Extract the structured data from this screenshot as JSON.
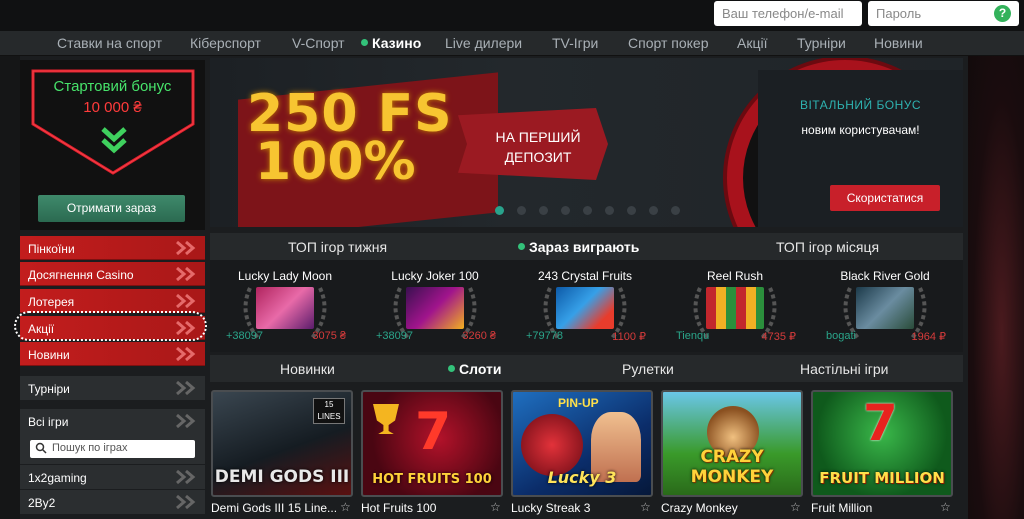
{
  "login": {
    "phone_placeholder": "Ваш телефон/e-mail",
    "password_placeholder": "Пароль",
    "help_label": "?"
  },
  "nav": {
    "items": [
      "Ставки на спорт",
      "Кіберспорт",
      "V-Спорт",
      "Казино",
      "Live дилери",
      "TV-Ігри",
      "Спорт покер",
      "Акції",
      "Турніри",
      "Новини"
    ],
    "active_index": 3
  },
  "bonus": {
    "title": "Стартовий бонус",
    "amount": "10 000 ₴",
    "button": "Отримати зараз"
  },
  "banner": {
    "fs_text": "250 FS",
    "percent_text": "100%",
    "ribbon_line1": "НА ПЕРШИЙ",
    "ribbon_line2": "ДЕПОЗИТ",
    "welcome_title": "ВІТАЛЬНИЙ БОНУС",
    "welcome_sub": "новим користувачам!",
    "use_button": "Скористатися",
    "slide_count": 9,
    "active_slide": 0
  },
  "sidebar": {
    "red_items": [
      "Пінкоїни",
      "Досягнення Casino",
      "Лотерея",
      "Акції",
      "Новини"
    ],
    "highlighted_index": 3,
    "tournaments": "Турніри",
    "all_games": "Всі ігри",
    "search_placeholder": "Пошук по іграх",
    "providers": [
      "1x2gaming",
      "2By2"
    ]
  },
  "top_tabs": {
    "items": [
      "ТОП ігор тижня",
      "Зараз виграють",
      "ТОП ігор місяця"
    ],
    "active_index": 1
  },
  "top_games": [
    {
      "title": "Lucky Lady Moon",
      "user": "+38097",
      "amount": "3075 ₴"
    },
    {
      "title": "Lucky Joker 100",
      "user": "+38097",
      "amount": "3260 ₴"
    },
    {
      "title": "243 Crystal Fruits",
      "user": "+79778",
      "amount": "1100 ₽"
    },
    {
      "title": "Reel Rush",
      "user": "Tienqu",
      "amount": "4735 ₽"
    },
    {
      "title": "Black River Gold",
      "user": "bogati",
      "amount": "1964 ₽"
    }
  ],
  "category_tabs": {
    "items": [
      "Новинки",
      "Слоти",
      "Рулетки",
      "Настільні ігри"
    ],
    "active_index": 1
  },
  "games": [
    {
      "name": "Demi Gods III 15 Line...",
      "logo": "DEMI GODS III",
      "badge": "15 LINES"
    },
    {
      "name": "Hot Fruits 100",
      "logo": "HOT FRUITS 100"
    },
    {
      "name": "Lucky Streak 3",
      "logo": "Lucky 3",
      "badge": "PIN-UP"
    },
    {
      "name": "Crazy Monkey",
      "logo": "CRAZY MONKEY"
    },
    {
      "name": "Fruit Million",
      "logo": "FRUIT MILLION"
    }
  ],
  "star_glyph": "☆",
  "colors": {
    "accent_green": "#33c27a",
    "red": "#c31d1d",
    "gold": "#f7c531",
    "teal": "#2aa58a"
  }
}
